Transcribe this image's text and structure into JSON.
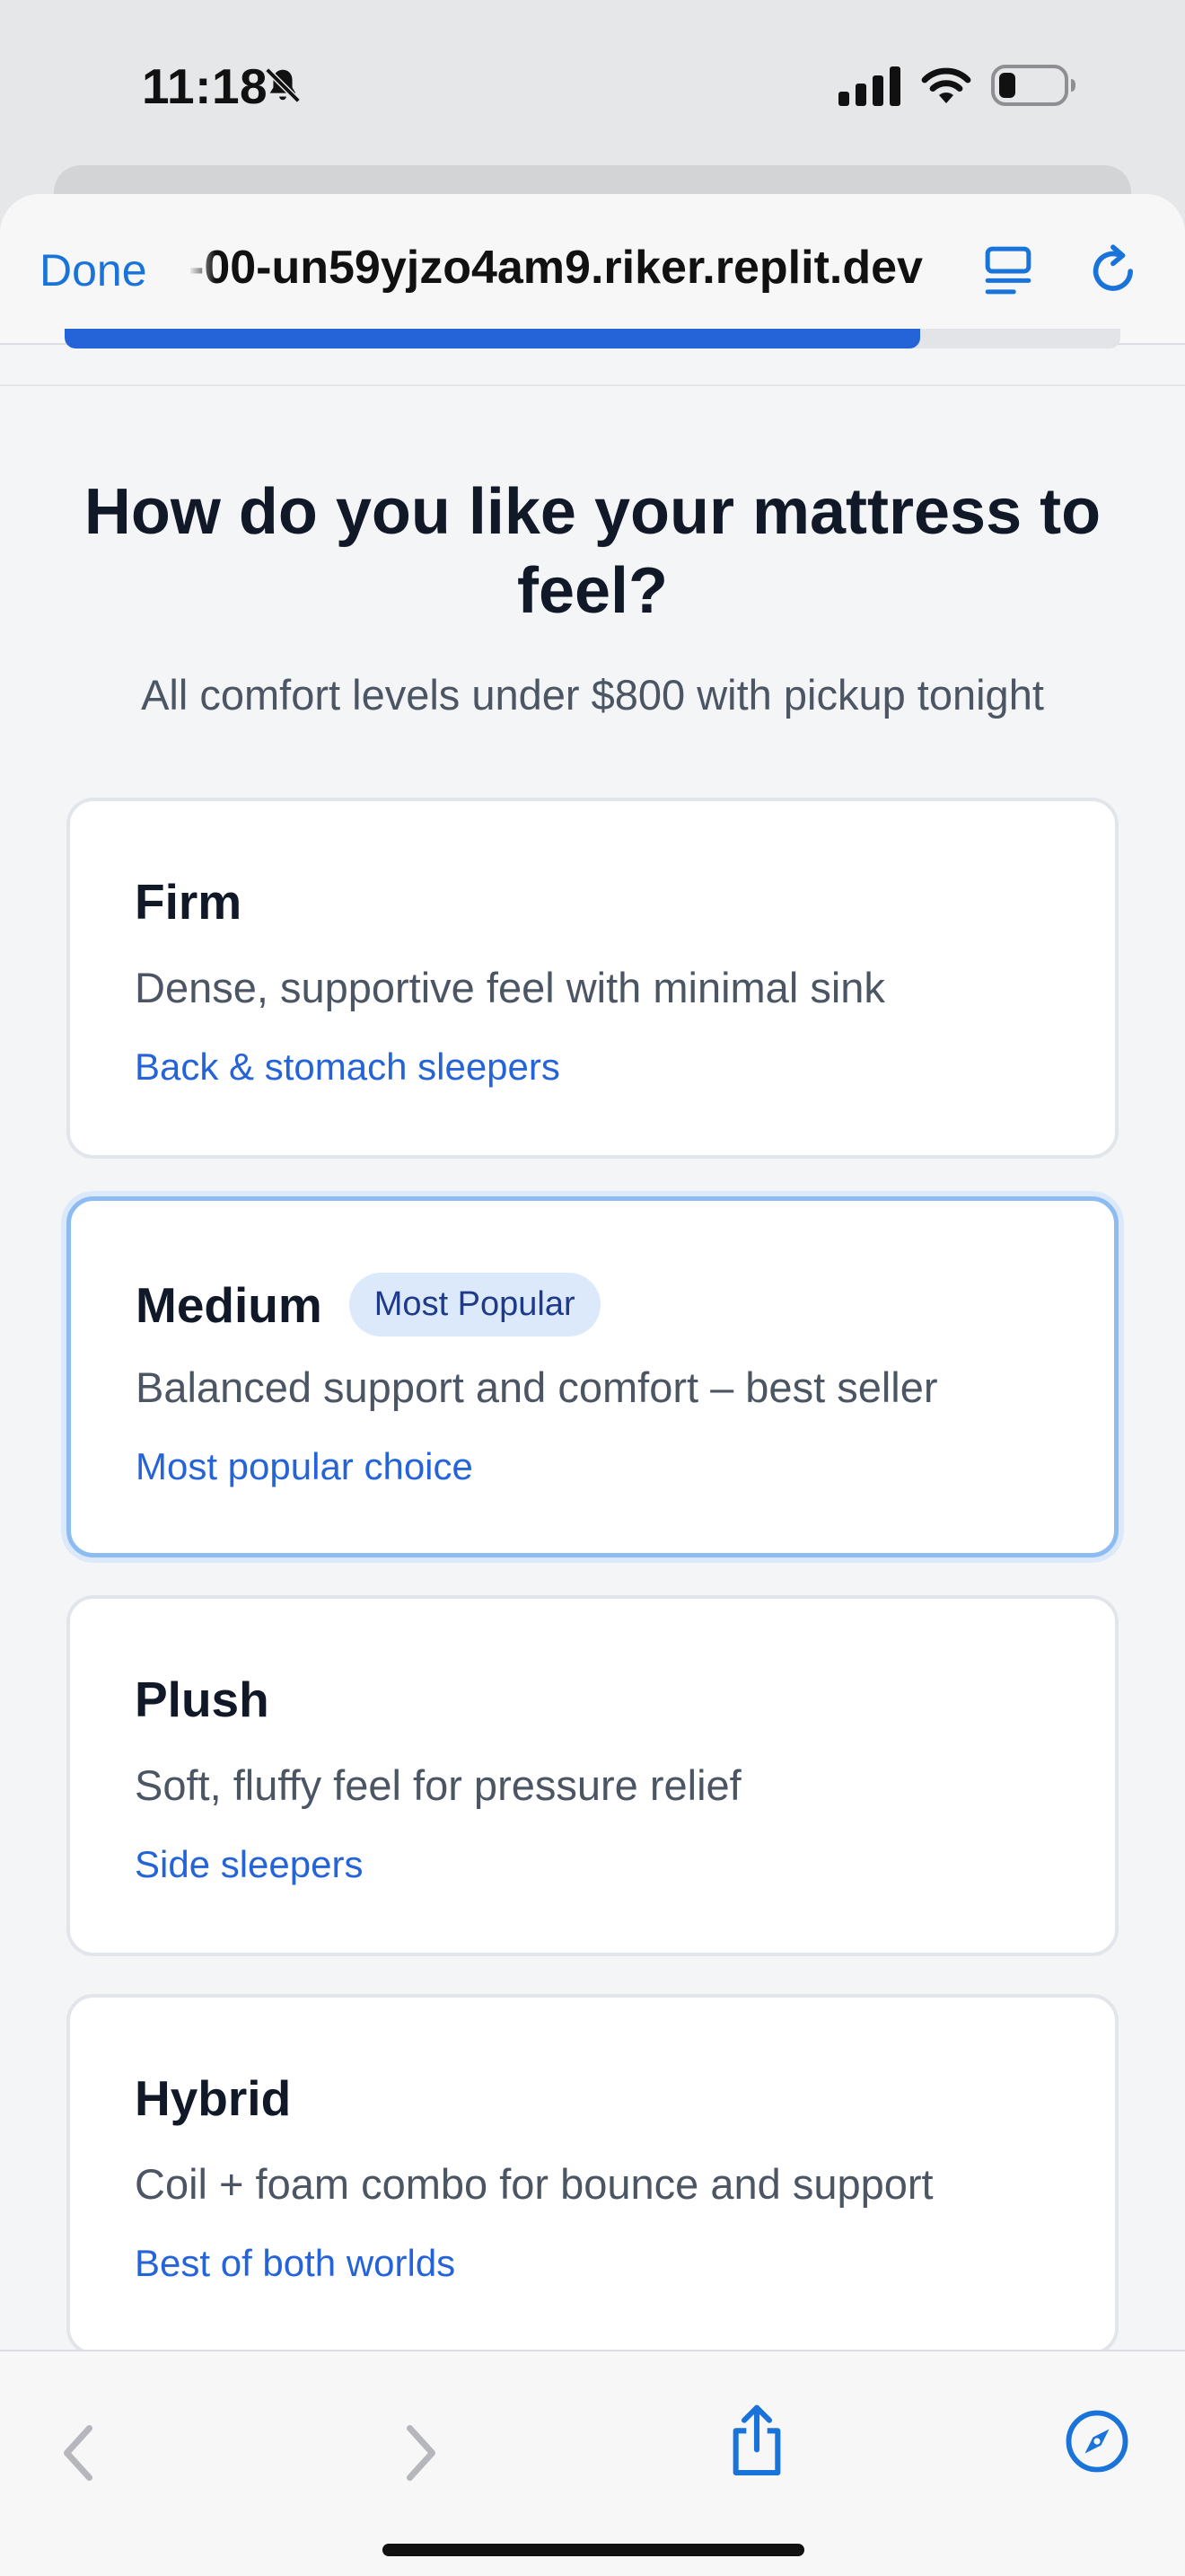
{
  "status_bar": {
    "time": "11:18",
    "icons": [
      "bell-slash-icon",
      "cellular-signal-icon",
      "wifi-icon",
      "battery-icon"
    ]
  },
  "browser": {
    "done_label": "Done",
    "url": "-00-un59yjzo4am9.riker.replit.dev",
    "reader_icon": "reader-mode-icon",
    "reload_icon": "reload-icon",
    "accent_color": "#1a73d9"
  },
  "quiz": {
    "progress_percent": 81,
    "title": "How do you like your mattress to feel?",
    "subtitle": "All comfort levels under $800 with pickup tonight",
    "options": [
      {
        "name": "Firm",
        "description": "Dense, supportive feel with minimal sink",
        "tag": "Back & stomach sleepers",
        "selected": false
      },
      {
        "name": "Medium",
        "badge": "Most Popular",
        "description": "Balanced support and comfort – best seller",
        "tag": "Most popular choice",
        "selected": true
      },
      {
        "name": "Plush",
        "description": "Soft, fluffy feel for pressure relief",
        "tag": "Side sleepers",
        "selected": false
      },
      {
        "name": "Hybrid",
        "description": "Coil + foam combo for bounce and support",
        "tag": "Best of both worlds",
        "selected": false
      }
    ],
    "colors": {
      "primary": "#2563d9",
      "selected_border": "#8dbcf2",
      "badge_bg": "#dce9fb"
    }
  },
  "bottom_bar": {
    "icons": [
      "back-chevron-icon",
      "forward-chevron-icon",
      "share-icon",
      "compass-icon"
    ]
  }
}
